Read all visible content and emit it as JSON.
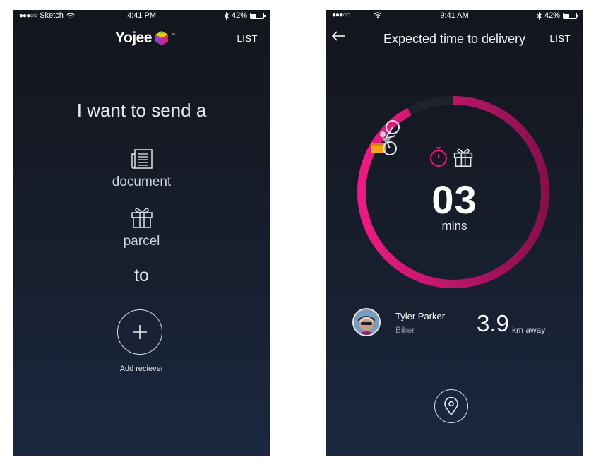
{
  "screen1": {
    "status": {
      "carrier": "Sketch",
      "signal_dots": "●●●○○",
      "time": "4:41 PM",
      "battery": "42%"
    },
    "brand": "Yojee",
    "list_label": "LIST",
    "headline": "I want to send a",
    "options": [
      {
        "label": "document",
        "icon": "document-icon"
      },
      {
        "label": "parcel",
        "icon": "gift-icon"
      }
    ],
    "connector": "to",
    "add_label": "Add reciever"
  },
  "screen2": {
    "status": {
      "signal_dots": "●●●○○",
      "time": "9:41 AM",
      "battery": "42%"
    },
    "title": "Expected time to delivery",
    "list_label": "LIST",
    "timer": {
      "value": "03",
      "unit": "mins",
      "progress": 0.92
    },
    "driver": {
      "name": "Tyler Parker",
      "role": "Biker",
      "distance": "3.9",
      "distance_unit": "km away"
    },
    "colors": {
      "accent": "#e5177b",
      "ring_track": "#20232c"
    }
  }
}
